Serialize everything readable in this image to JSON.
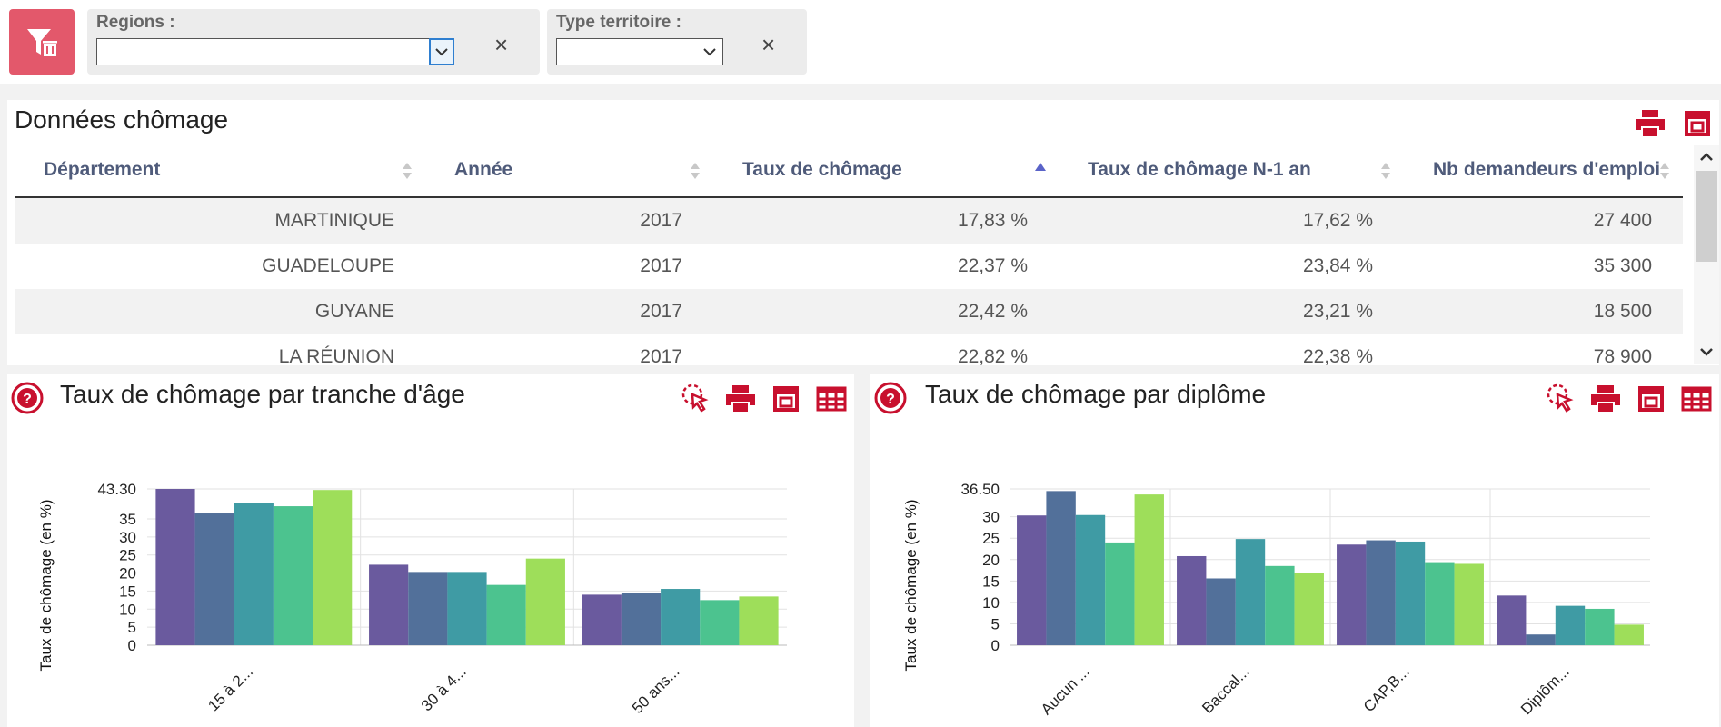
{
  "filters": {
    "regions_label": "Regions :",
    "regions_value": "",
    "type_label": "Type territoire :",
    "type_value": "",
    "clear_symbol": "×"
  },
  "table_panel": {
    "title": "Données chômage",
    "columns": [
      "Département",
      "Année",
      "Taux de chômage",
      "Taux de chômage N-1 an",
      "Nb demandeurs d'emploi"
    ],
    "sorted_column": "Taux de chômage",
    "sort_direction": "ascending",
    "rows": [
      [
        "MARTINIQUE",
        "2017",
        "17,83 %",
        "17,62 %",
        "27 400"
      ],
      [
        "GUADELOUPE",
        "2017",
        "22,37 %",
        "23,84 %",
        "35 300"
      ],
      [
        "GUYANE",
        "2017",
        "22,42 %",
        "23,21 %",
        "18 500"
      ],
      [
        "LA RÉUNION",
        "2017",
        "22,82 %",
        "22,38 %",
        "78 900"
      ]
    ]
  },
  "chart_age": {
    "title": "Taux de chômage par tranche d'âge"
  },
  "chart_diploma": {
    "title": "Taux de chômage par diplôme"
  },
  "colors": {
    "accent": "#c8102e",
    "series": [
      "#6a5a9e",
      "#52709a",
      "#3f9ba4",
      "#4cc38f",
      "#9ede5a"
    ]
  },
  "chart_data": [
    {
      "type": "bar",
      "title": "Taux de chômage par tranche d'âge",
      "ylabel": "Taux de chômage (en %)",
      "xlabel": "",
      "categories": [
        "15 à 2...",
        "30 à 4...",
        "50 ans..."
      ],
      "series": [
        {
          "values": [
            43.3,
            36.5,
            39.3,
            38.5,
            43.0
          ]
        },
        {
          "values": [
            22.3,
            20.3,
            20.3,
            16.7,
            24.0
          ]
        },
        {
          "values": [
            14.0,
            14.6,
            15.6,
            12.5,
            13.5
          ]
        }
      ],
      "ylim": [
        0,
        43.3
      ],
      "yticks": [
        "0",
        "5",
        "10",
        "15",
        "20",
        "25",
        "30",
        "35",
        "43.30"
      ],
      "grid": true
    },
    {
      "type": "bar",
      "title": "Taux de chômage par diplôme",
      "ylabel": "Taux de chômage (en %)",
      "xlabel": "",
      "categories": [
        "Aucun ...",
        "Baccal...",
        "CAP,B...",
        "Diplôm..."
      ],
      "series": [
        {
          "values": [
            30.3,
            36.0,
            30.4,
            24.0,
            35.2
          ]
        },
        {
          "values": [
            20.8,
            15.6,
            24.8,
            18.5,
            16.8
          ]
        },
        {
          "values": [
            23.5,
            24.5,
            24.2,
            19.4,
            19.0
          ]
        },
        {
          "values": [
            11.6,
            2.5,
            9.2,
            8.5,
            4.8
          ]
        }
      ],
      "ylim": [
        0,
        36.5
      ],
      "yticks": [
        "0",
        "5",
        "10",
        "15",
        "20",
        "25",
        "30",
        "36.50"
      ],
      "grid": true
    }
  ]
}
